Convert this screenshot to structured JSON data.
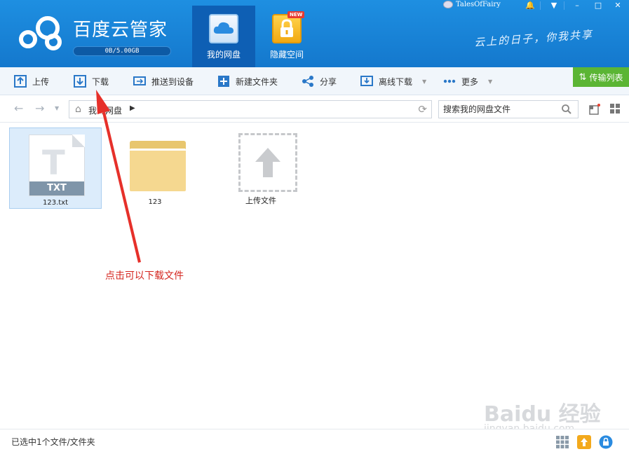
{
  "app": {
    "name": "百度云管家",
    "quota": "0B/5.00GB",
    "slogan": "云上的日子，你我共享",
    "user": "TalesOfFairy"
  },
  "nav_tabs": [
    {
      "label": "我的网盘",
      "active": true,
      "icon": "cloud-disk-icon"
    },
    {
      "label": "隐藏空间",
      "active": false,
      "icon": "lock-icon",
      "badge": "NEW"
    }
  ],
  "toolbar": {
    "upload": "上传",
    "download": "下载",
    "push_to_device": "推送到设备",
    "new_folder": "新建文件夹",
    "share": "分享",
    "offline_download": "离线下载",
    "more": "更多",
    "transfer_list": "传输列表"
  },
  "address": {
    "breadcrumb": "我的网盘",
    "search_placeholder": "搜索我的网盘文件"
  },
  "files": [
    {
      "name": "123.txt",
      "type": "txt",
      "type_label": "TXT",
      "selected": true
    },
    {
      "name": "123",
      "type": "folder",
      "selected": false
    },
    {
      "name": "上传文件",
      "type": "upload",
      "selected": false
    }
  ],
  "annotation": {
    "text": "点击可以下载文件",
    "color": "#d4261f"
  },
  "watermark": {
    "brand": "Baidu 经验",
    "url": "jingyan.baidu.com"
  },
  "status": {
    "text": "已选中1个文件/文件夹"
  },
  "colors": {
    "header": "#1a86dd",
    "active_tab": "#0e5fb4",
    "transfer_button": "#5bb534",
    "selection": "#dcecfb"
  }
}
